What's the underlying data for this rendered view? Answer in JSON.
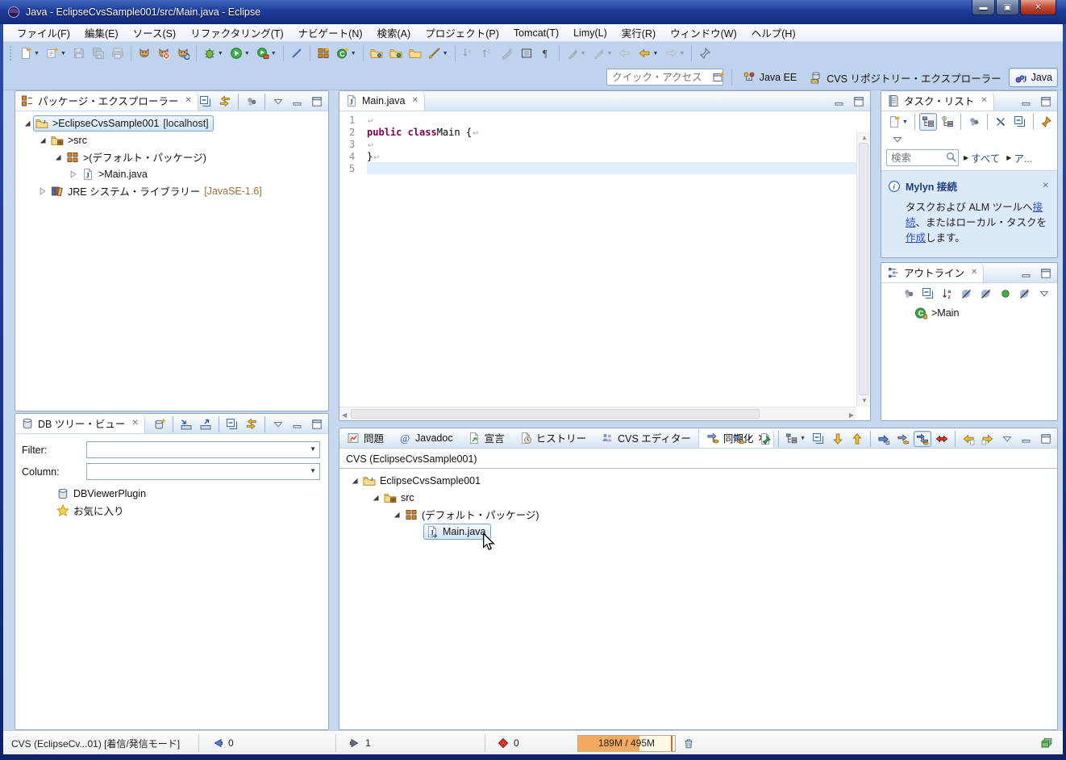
{
  "window": {
    "title": "Java - EclipseCvsSample001/src/Main.java - Eclipse"
  },
  "window_controls": {
    "minimize": "minimize",
    "maximize": "maximize",
    "close": "close"
  },
  "menu": {
    "items": [
      "ファイル(F)",
      "編集(E)",
      "ソース(S)",
      "リファクタリング(T)",
      "ナビゲート(N)",
      "検索(A)",
      "プロジェクト(P)",
      "Tomcat(T)",
      "Limy(L)",
      "実行(R)",
      "ウィンドウ(W)",
      "ヘルプ(H)"
    ]
  },
  "main_toolbar": {
    "groups": [
      [
        {
          "name": "new-wizard",
          "dd": true
        },
        {
          "name": "new-java-ee",
          "dd": true
        },
        {
          "name": "save",
          "dis": true
        },
        {
          "name": "save-all",
          "dis": true
        },
        {
          "name": "print",
          "dis": true
        }
      ],
      [
        {
          "name": "tomcat-start"
        },
        {
          "name": "tomcat-stop"
        },
        {
          "name": "tomcat-restart"
        }
      ],
      [
        {
          "name": "debug",
          "dd": true
        },
        {
          "name": "run",
          "dd": true
        },
        {
          "name": "run-history",
          "dd": true
        }
      ],
      [
        {
          "name": "external-tools"
        }
      ],
      [
        {
          "name": "new-java-project"
        },
        {
          "name": "new-class",
          "dd": true
        }
      ],
      [
        {
          "name": "open-task-folder"
        },
        {
          "name": "search-folder"
        },
        {
          "name": "open-folder"
        },
        {
          "name": "format-brush",
          "dd": true
        }
      ],
      [
        {
          "name": "next-annotation",
          "dis": true
        },
        {
          "name": "prev-annotation",
          "dis": true
        },
        {
          "name": "mark-occurrences",
          "dis": true
        },
        {
          "name": "block-selection"
        },
        {
          "name": "show-whitespace"
        }
      ],
      [
        {
          "name": "last-edit-location",
          "dis": true,
          "dd": true
        },
        {
          "name": "goto-last-edit",
          "dis": true,
          "dd": true
        },
        {
          "name": "back-disabled",
          "dis": true
        },
        {
          "name": "back",
          "dd": true
        },
        {
          "name": "forward",
          "dis": true,
          "dd": true
        }
      ],
      [
        {
          "name": "pin-editor"
        }
      ]
    ]
  },
  "quick_access": {
    "placeholder": "クイック・アクセス"
  },
  "perspective_bar": {
    "open_button": {
      "name": "open-perspective"
    },
    "buttons": [
      {
        "icon": "javaee-perspective",
        "label": "Java EE"
      },
      {
        "icon": "cvs-perspective",
        "label": "CVS リポジトリー・エクスプローラー"
      },
      {
        "icon": "java-perspective",
        "label": "Java",
        "active": true
      }
    ]
  },
  "package_explorer": {
    "title": "パッケージ・エクスプローラー",
    "toolbar": [
      [
        {
          "name": "collapse-all"
        },
        {
          "name": "link-with-editor"
        }
      ],
      [
        {
          "name": "focus"
        }
      ],
      [
        {
          "name": "view-menu"
        },
        {
          "name": "minimize-view"
        },
        {
          "name": "maximize-view"
        }
      ]
    ],
    "tree": [
      {
        "indent": 0,
        "expander": "expanded",
        "icon": "project-folder",
        "label": ">EclipseCvsSample001",
        "suffix": "  [localhost]",
        "suffix_class": "",
        "selected": true
      },
      {
        "indent": 1,
        "expander": "expanded",
        "icon": "src-folder",
        "label": ">src"
      },
      {
        "indent": 2,
        "expander": "expanded",
        "icon": "package",
        "label": ">(デフォルト・パッケージ)"
      },
      {
        "indent": 3,
        "expander": "collapsed",
        "icon": "java-file",
        "label": ">Main.java"
      },
      {
        "indent": 1,
        "expander": "collapsed",
        "icon": "jre-library",
        "label": "JRE システム・ライブラリー",
        "suffix": " [JavaSE-1.6]",
        "suffix_class": "lib"
      }
    ]
  },
  "editor": {
    "tab": "Main.java",
    "return_glyph": "↵",
    "lines": [
      {
        "num": "1",
        "segments": [],
        "ret": true
      },
      {
        "num": "2",
        "segments": [
          {
            "text": "public class ",
            "style": "kw"
          },
          {
            "text": "Main {",
            "style": "pl"
          }
        ],
        "ret": true
      },
      {
        "num": "3",
        "segments": [],
        "ret": true
      },
      {
        "num": "4",
        "segments": [
          {
            "text": "}",
            "style": "pl"
          }
        ],
        "ret": true
      },
      {
        "num": "5",
        "segments": [],
        "ret": false,
        "current": true
      }
    ]
  },
  "task_list": {
    "title": "タスク・リスト",
    "toolbar": [
      [
        {
          "name": "new-task",
          "dd": true
        }
      ],
      [
        {
          "name": "categorized-presentation",
          "pressed": true
        },
        {
          "name": "scheduled-presentation"
        }
      ],
      [
        {
          "name": "focus"
        }
      ],
      [
        {
          "name": "hide-completed"
        },
        {
          "name": "collapse-all"
        }
      ],
      [
        {
          "name": "task-overflow"
        }
      ]
    ],
    "menu_row": [
      [
        {
          "name": "view-menu"
        }
      ]
    ],
    "search": {
      "placeholder": "検索"
    },
    "filters": [
      {
        "label": "すべて"
      },
      {
        "label": "ア..."
      }
    ],
    "mylyn": {
      "title": "Mylyn 接続",
      "body": [
        {
          "text": "タスクおよび ALM ツールへ"
        },
        {
          "text": "接続",
          "link": true
        },
        {
          "text": "、またはローカル・タスクを"
        },
        {
          "text": "作成",
          "link": true
        },
        {
          "text": "します。"
        }
      ]
    }
  },
  "outline": {
    "title": "アウトライン",
    "toolbar": [
      [
        {
          "name": "focus"
        },
        {
          "name": "collapse-all"
        },
        {
          "name": "sort-alphabetical"
        },
        {
          "name": "hide-fields"
        },
        {
          "name": "hide-static"
        },
        {
          "name": "hide-non-public"
        },
        {
          "name": "hide-local"
        },
        {
          "name": "view-menu"
        }
      ]
    ],
    "tree": [
      {
        "indent": 0,
        "expander": "none",
        "icon": "class",
        "label": ">Main"
      }
    ]
  },
  "db_view": {
    "title": "DB ツリー・ビュー",
    "toolbar": [
      [
        {
          "name": "new-database"
        }
      ],
      [
        {
          "name": "import-db"
        },
        {
          "name": "export-db"
        }
      ],
      [
        {
          "name": "collapse-all"
        },
        {
          "name": "link-with-editor"
        }
      ],
      [
        {
          "name": "view-menu"
        },
        {
          "name": "minimize-view"
        },
        {
          "name": "maximize-view"
        }
      ]
    ],
    "filter_label": "Filter:",
    "column_label": "Column:",
    "tree": [
      {
        "indent": 0,
        "expander": "none",
        "icon": "db",
        "label": "DBViewerPlugin"
      },
      {
        "indent": 0,
        "expander": "none",
        "icon": "star",
        "label": "お気に入り"
      }
    ]
  },
  "bottom_panel": {
    "tabs": [
      {
        "icon": "problems",
        "label": "問題"
      },
      {
        "icon": "javadoc-at",
        "label": "Javadoc"
      },
      {
        "icon": "declaration",
        "label": "宣言"
      },
      {
        "icon": "history",
        "label": "ヒストリー"
      },
      {
        "icon": "cvs-editor",
        "label": "CVS エディター"
      },
      {
        "icon": "synchronize",
        "label": "同期化",
        "active": true,
        "closable": true
      }
    ],
    "toolbar": [
      [
        {
          "name": "synchronize",
          "dd": true
        },
        {
          "name": "pin-current"
        }
      ],
      [
        {
          "name": "presentation-mode",
          "dd": true
        },
        {
          "name": "collapse-all"
        },
        {
          "name": "next-change"
        },
        {
          "name": "prev-change"
        }
      ],
      [
        {
          "name": "incoming-mode"
        },
        {
          "name": "outgoing-mode"
        },
        {
          "name": "both-mode",
          "pressed": true
        },
        {
          "name": "conflicts-mode"
        }
      ],
      [
        {
          "name": "update-all"
        },
        {
          "name": "commit-all"
        },
        {
          "name": "view-menu"
        },
        {
          "name": "minimize-view"
        },
        {
          "name": "maximize-view"
        }
      ]
    ],
    "sync": {
      "header": "CVS (EclipseCvsSample001)",
      "tree": [
        {
          "indent": 0,
          "expander": "expanded",
          "icon": "project-folder",
          "label": "EclipseCvsSample001"
        },
        {
          "indent": 1,
          "expander": "expanded",
          "icon": "src-folder",
          "label": "src"
        },
        {
          "indent": 2,
          "expander": "expanded",
          "icon": "package",
          "label": "(デフォルト・パッケージ)"
        },
        {
          "indent": 3,
          "expander": "none",
          "icon": "java-file-outgoing",
          "label": "Main.java",
          "selected": true
        }
      ]
    }
  },
  "status_bar": {
    "cvs_label": "CVS (EclipseCv...01) [着信/発信モード]",
    "incoming": {
      "count": "0"
    },
    "outgoing": {
      "count": "1"
    },
    "conflicts": {
      "count": "0"
    },
    "memory": {
      "used": "189M",
      "sep": " / ",
      "total": "495M"
    }
  },
  "colors": {
    "titlebar": "#1e3c9a",
    "toolbar_bg": "#bfd4ec",
    "selection": "#cfe5f8",
    "keyword": "#7f0055",
    "link": "#2a50c8",
    "memory_fill": "#f4ab5f"
  }
}
